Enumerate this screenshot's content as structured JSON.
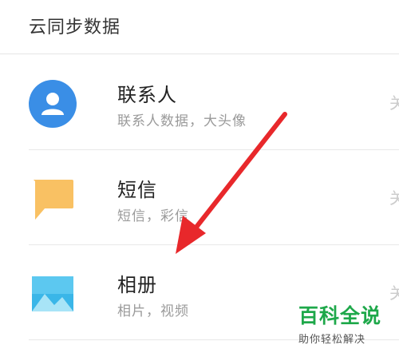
{
  "header": {
    "title": "云同步数据"
  },
  "items": [
    {
      "title": "联系人",
      "subtitle": "联系人数据，大头像",
      "icon": "contacts-icon",
      "color": "#3a8ee6",
      "switch_label": "关"
    },
    {
      "title": "短信",
      "subtitle": "短信，彩信",
      "icon": "sms-icon",
      "color": "#f6b74a",
      "switch_label": "关"
    },
    {
      "title": "相册",
      "subtitle": "相片，视频",
      "icon": "gallery-icon",
      "color": "#3ab6e8",
      "switch_label": "关"
    }
  ],
  "annotation": {
    "arrow_color": "#e8282b"
  },
  "watermark": {
    "main": "百科全说",
    "sub": "助你轻松解决"
  }
}
